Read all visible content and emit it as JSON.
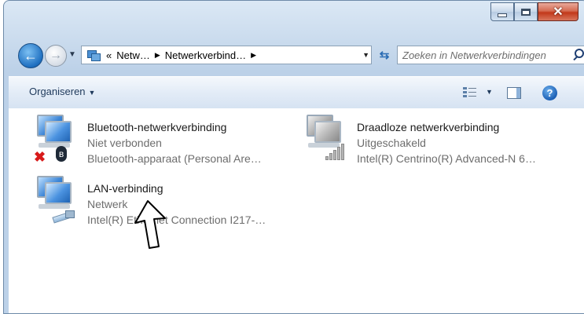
{
  "window": {
    "caption_buttons": {
      "minimize": "minimize-icon",
      "maximize": "maximize-icon",
      "close": "close-icon"
    }
  },
  "navigation": {
    "back_icon": "back-arrow-icon",
    "forward_icon": "forward-arrow-icon",
    "address": {
      "prefix": "«",
      "crumbs": [
        "Netw…",
        "Netwerkverbind…"
      ],
      "separator": "▶"
    },
    "refresh_icon": "refresh-icon",
    "search": {
      "placeholder": "Zoeken in Netwerkverbindingen"
    }
  },
  "toolbar": {
    "organise_label": "Organiseren",
    "caret": "▼",
    "view_icon": "change-view-icon",
    "preview_pane_icon": "preview-pane-icon",
    "help_icon": "help-icon"
  },
  "connections": [
    {
      "name": "Bluetooth-netwerkverbinding",
      "status": "Niet verbonden",
      "device": "Bluetooth-apparaat (Personal Are…"
    },
    {
      "name": "Draadloze netwerkverbinding",
      "status": "Uitgeschakeld",
      "device": "Intel(R) Centrino(R) Advanced-N 6…"
    },
    {
      "name": "LAN-verbinding",
      "status": "Netwerk",
      "device": "Intel(R) Ethernet Connection I217-…"
    }
  ],
  "colors": {
    "accent": "#1e395b",
    "status_gray": "#6d6d6d",
    "error_red": "#d81a1a"
  }
}
